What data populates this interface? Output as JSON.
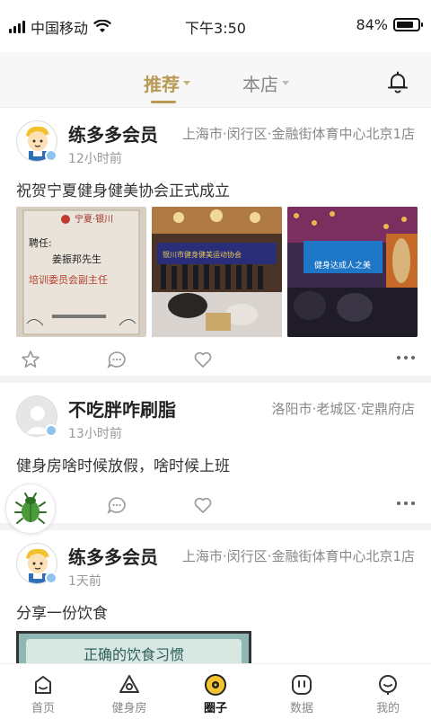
{
  "status_bar": {
    "carrier": "中国移动",
    "time": "下午3:50",
    "battery": "84%",
    "battery_level": 0.84
  },
  "header": {
    "tabs": [
      {
        "label": "推荐",
        "active": true
      },
      {
        "label": "本店",
        "active": false
      }
    ],
    "bell_icon": "bell-icon"
  },
  "posts": [
    {
      "username": "练多多会员",
      "location": "上海市·闵行区·金融街体育中心北京1店",
      "time": "12小时前",
      "content": "祝贺宁夏健身健美协会正式成立",
      "images": [
        {
          "text_top": "宁夏·银川",
          "text_mid": "聘任:",
          "text_name": "姜振邦先生",
          "text_role": "培训委员会副主任"
        },
        {
          "text_banner": "银川市健身健美运动协会"
        },
        {
          "text_banner": "健身达成人之美"
        }
      ]
    },
    {
      "username": "不吃胖咋刷脂",
      "location": "洛阳市·老城区·定鼎府店",
      "time": "13小时前",
      "content": "健身房啥时候放假，啥时候上班"
    },
    {
      "username": "练多多会员",
      "location": "上海市·闵行区·金融街体育中心北京1店",
      "time": "1天前",
      "content": "分享一份饮食",
      "image_title": "正确的饮食习惯"
    }
  ],
  "bottom_nav": [
    {
      "label": "首页",
      "icon": "home-icon",
      "active": false
    },
    {
      "label": "健身房",
      "icon": "gym-icon",
      "active": false
    },
    {
      "label": "圈子",
      "icon": "circle-icon",
      "active": true
    },
    {
      "label": "数据",
      "icon": "data-icon",
      "active": false
    },
    {
      "label": "我的",
      "icon": "profile-icon",
      "active": false
    }
  ],
  "colors": {
    "accent": "#b89a55",
    "nav_active": "#f4c430",
    "verified": "#8fc3ef"
  }
}
